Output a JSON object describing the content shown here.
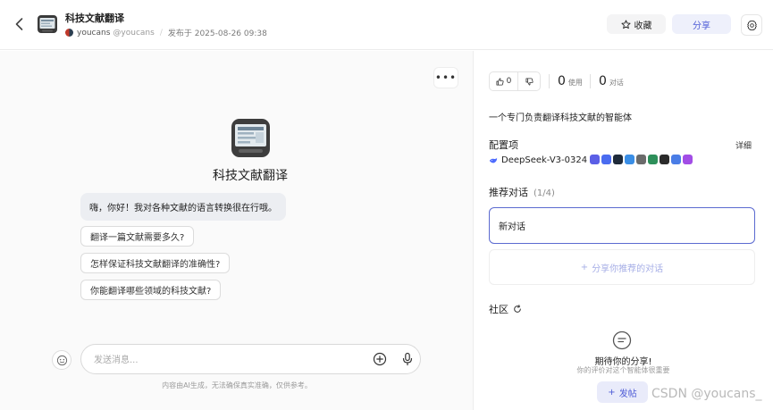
{
  "header": {
    "title": "科技文献翻译",
    "author_name": "youcans",
    "author_handle": "@youcans",
    "published": "发布于 2025-08-26 09:38",
    "favorite_label": "收藏",
    "share_label": "分享"
  },
  "chat": {
    "bot_name": "科技文献翻译",
    "greeting": "嗨，你好！我对各种文献的语言转换很在行哦。",
    "suggestions": [
      "翻译一篇文献需要多久?",
      "怎样保证科技文献翻译的准确性?",
      "你能翻译哪些领域的科技文献?"
    ],
    "input_placeholder": "发送消息...",
    "disclaimer": "内容由AI生成，无法确保真实准确，仅供参考。"
  },
  "panel": {
    "likes": "0",
    "usage_count": "0",
    "usage_label": "使用",
    "dialog_count": "0",
    "dialog_label": "对话",
    "description": "一个专门负责翻译科技文献的智能体",
    "config_title": "配置项",
    "config_detail": "详细",
    "model_name": "DeepSeek-V3-0324",
    "tool_colors": [
      "#5b5fe6",
      "#4a6cf0",
      "#1f2b3a",
      "#3a8ee6",
      "#6b6b6b",
      "#2d8f5a",
      "#2b2b2b",
      "#4a7de6",
      "#a24de6"
    ],
    "recommend_title": "推荐对话",
    "recommend_count": "(1/4)",
    "recommend_item": "新对话",
    "share_recommend": "分享你推荐的对话",
    "community_title": "社区",
    "empty_title": "期待你的分享!",
    "empty_sub": "你的评价对这个智能体很重要",
    "post_label": "发帖"
  },
  "watermark": "CSDN @youcans_",
  "colors": {
    "accent": "#4d5bd6",
    "accent_bg": "#eef0fb",
    "chat_bg": "#fafafa"
  }
}
